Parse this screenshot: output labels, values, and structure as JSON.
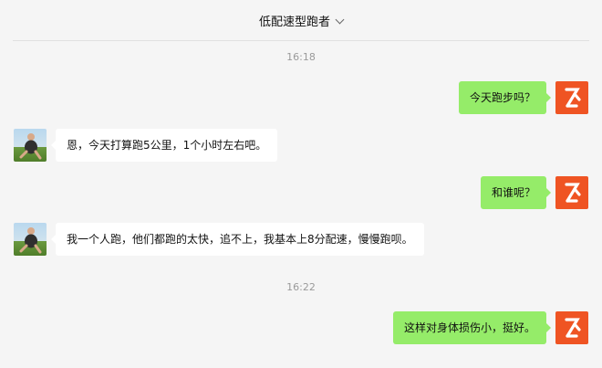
{
  "header": {
    "title": "低配速型跑者"
  },
  "messages": [
    {
      "type": "time",
      "text": "16:18"
    },
    {
      "type": "msg",
      "from": "me",
      "text": "今天跑步吗？"
    },
    {
      "type": "msg",
      "from": "other",
      "text": "恩，今天打算跑5公里，1个小时左右吧。"
    },
    {
      "type": "msg",
      "from": "me",
      "text": "和谁呢？"
    },
    {
      "type": "msg",
      "from": "other",
      "text": "我一个人跑，他们都跑的太快，追不上，我基本上8分配速，慢慢跑呗。"
    },
    {
      "type": "time",
      "text": "16:22"
    },
    {
      "type": "msg",
      "from": "me",
      "text": "这样对身体损伤小，挺好。"
    }
  ],
  "colors": {
    "me_bubble": "#95ec69",
    "other_bubble": "#ffffff",
    "me_avatar": "#ef5423",
    "background": "#f5f5f5"
  },
  "icons": {
    "title_dropdown": "chevron-down-icon",
    "me_avatar": "brand-logo-avatar",
    "other_avatar": "runner-photo-avatar"
  }
}
